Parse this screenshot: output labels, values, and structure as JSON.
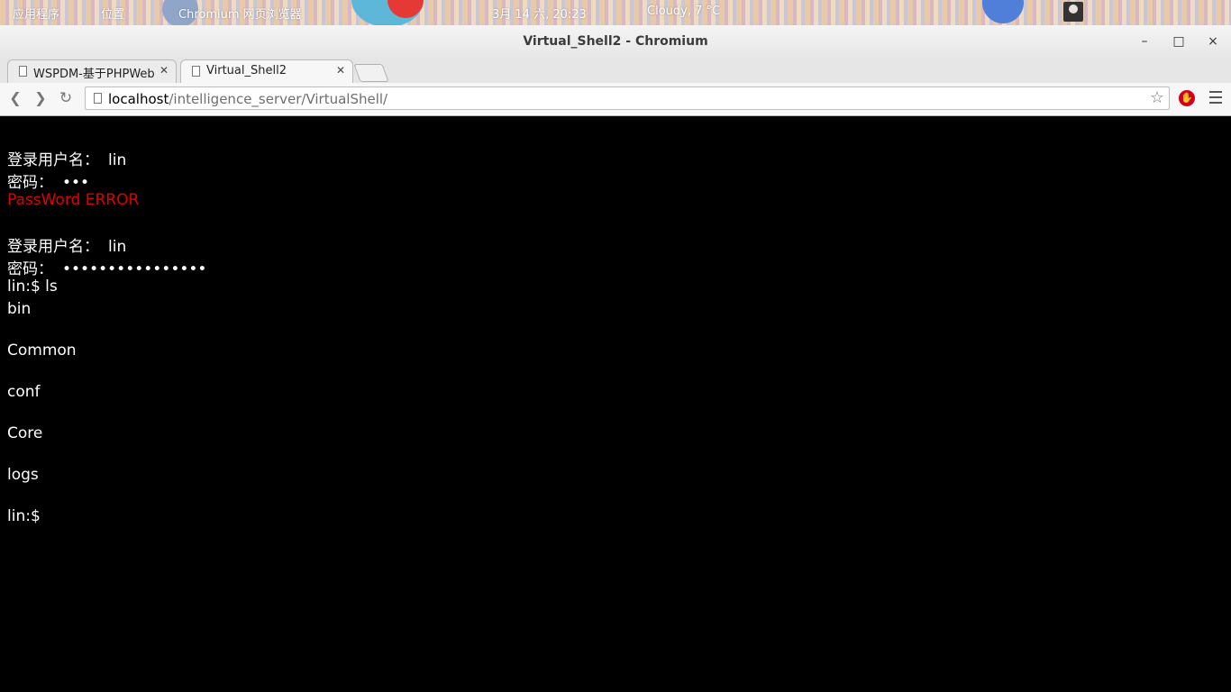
{
  "panel": {
    "items": [
      "应用程序",
      "位置",
      "Chromium 网页浏览器",
      "3月 14 六, 20:23",
      "Cloudy, 7 °C"
    ]
  },
  "window": {
    "title": "Virtual_Shell2 - Chromium",
    "controls": {
      "minimize": "–",
      "maximize": "□",
      "close": "×"
    }
  },
  "tabs": [
    {
      "label": "WSPDM-基于PHPWeb",
      "active": false
    },
    {
      "label": "Virtual_Shell2",
      "active": true
    }
  ],
  "address": {
    "host": "localhost",
    "path": "/intelligence_server/VirtualShell/"
  },
  "terminal": {
    "login1": {
      "label": "登录用户名：",
      "value": "lin"
    },
    "pass1": {
      "label": "密码：",
      "value": "•••"
    },
    "error": "PassWord ERROR",
    "login2": {
      "label": "登录用户名：",
      "value": "lin"
    },
    "pass2": {
      "label": "密码：",
      "value": "••••••••••••••••"
    },
    "command": "lin:$  ls",
    "output": [
      "bin",
      "Common",
      "conf",
      "Core",
      "logs"
    ],
    "prompt": "lin:$"
  },
  "colors": {
    "error": "#e00000",
    "background": "#000000",
    "text": "#ffffff"
  }
}
